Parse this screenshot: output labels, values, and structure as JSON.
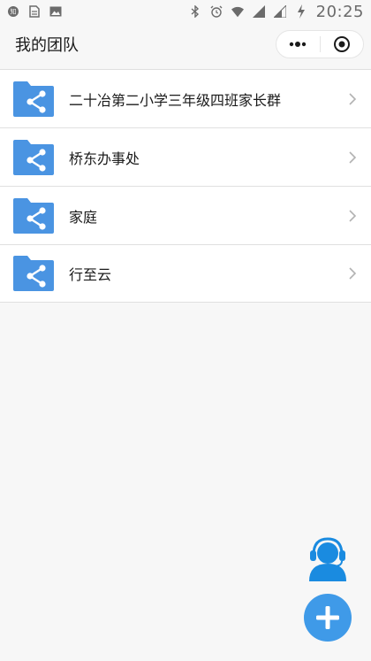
{
  "status_bar": {
    "time": "20:25"
  },
  "header": {
    "title": "我的团队"
  },
  "teams": [
    {
      "label": "二十冶第二小学三年级四班家长群"
    },
    {
      "label": "桥东办事处"
    },
    {
      "label": "家庭"
    },
    {
      "label": "行至云"
    }
  ],
  "colors": {
    "folder": "#4a94e2",
    "accent": "#3f9ae8"
  },
  "icons": {
    "list_item": "shared-folder-icon",
    "support": "headset-support-icon",
    "add": "plus-icon"
  }
}
